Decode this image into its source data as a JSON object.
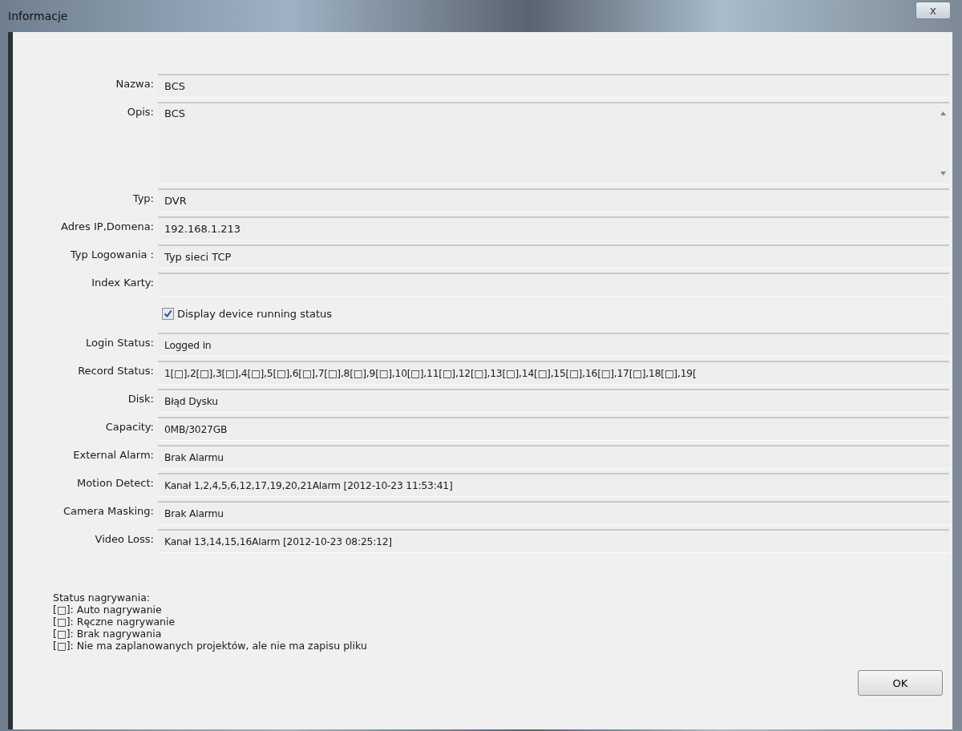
{
  "window": {
    "title": "Informacje",
    "close": "x"
  },
  "fields": [
    {
      "kind": "text",
      "label": "Nazwa:",
      "value": "BCS"
    },
    {
      "kind": "multiline",
      "label": "Opis:",
      "value": "BCS"
    },
    {
      "kind": "text",
      "label": "Typ:",
      "value": "DVR"
    },
    {
      "kind": "text",
      "label": "Adres IP,Domena:",
      "value": "192.168.1.213"
    },
    {
      "kind": "text",
      "label": "Typ Logowania :",
      "value": "Typ sieci TCP"
    },
    {
      "kind": "text",
      "label": "Index Karty:"
    }
  ],
  "status_checkbox": {
    "label": "Display device running status",
    "checked": true
  },
  "status_fields": [
    {
      "label": "Login Status:",
      "value": "Logged in"
    },
    {
      "label": "Record Status:",
      "value": "1[□],2[□],3[□],4[□],5[□],6[□],7[□],8[□],9[□],10[□],11[□],12[□],13[□],14[□],15[□],16[□],17[□],18[□],19["
    },
    {
      "label": "Disk:",
      "value": "Błąd Dysku"
    },
    {
      "label": "Capacity:",
      "value": "0MB/3027GB"
    },
    {
      "label": "External Alarm:",
      "value": "Brak Alarmu"
    },
    {
      "label": "Motion Detect:",
      "value": "Kanał 1,2,4,5,6,12,17,19,20,21Alarm [2012-10-23 11:53:41]"
    },
    {
      "label": "Camera Masking:",
      "value": "Brak Alarmu"
    },
    {
      "label": "Video Loss:",
      "value": "Kanał 13,14,15,16Alarm [2012-10-23 08:25:12]"
    }
  ],
  "legend": {
    "title": "Status nagrywania:",
    "lines": [
      "[□]: Auto nagrywanie",
      "[□]: Ręczne nagrywanie",
      "[□]: Brak nagrywania",
      "[□]: Nie ma zaplanowanych projektów, ale nie ma zapisu pliku"
    ]
  },
  "buttons": [
    "OK"
  ]
}
